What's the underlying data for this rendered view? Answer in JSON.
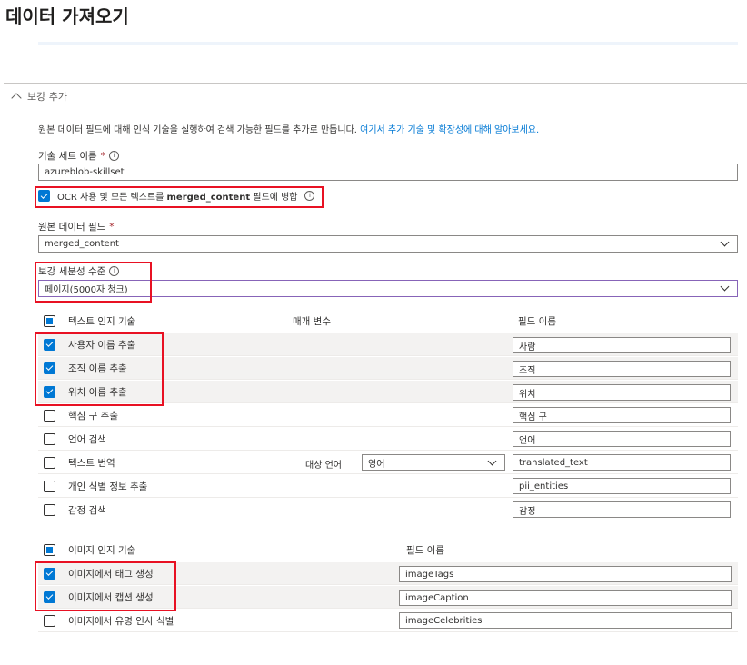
{
  "page": {
    "title": "데이터 가져오기"
  },
  "section": {
    "title": "보강 추가"
  },
  "description": {
    "text": "원본 데이터 필드에 대해 인식 기술을 실행하여 검색 가능한 필드를 추가로 만듭니다. ",
    "link": "여기서 추가 기술 및 확장성에 대해 알아보세요."
  },
  "skillset": {
    "label": "기술 세트 이름",
    "value": "azureblob-skillset"
  },
  "ocr": {
    "label_prefix": "OCR 사용 및 모든 텍스트를 ",
    "label_bold": "merged_content",
    "label_suffix": " 필드에 병합",
    "checked": true
  },
  "source_field": {
    "label": "원본 데이터 필드",
    "value": "merged_content"
  },
  "granularity": {
    "label": "보강 세분성 수준",
    "value": "페이지(5000자 청크)"
  },
  "text_skills": {
    "header": "텍스트 인지 기술",
    "param_header": "매개 변수",
    "field_header": "필드 이름",
    "items": [
      {
        "label": "사용자 이름 추출",
        "checked": true,
        "field": "사람"
      },
      {
        "label": "조직 이름 추출",
        "checked": true,
        "field": "조직"
      },
      {
        "label": "위치 이름 추출",
        "checked": true,
        "field": "위치"
      },
      {
        "label": "핵심 구 추출",
        "checked": false,
        "field": "핵심 구"
      },
      {
        "label": "언어 검색",
        "checked": false,
        "field": "언어"
      },
      {
        "label": "텍스트 번역",
        "checked": false,
        "field": "translated_text",
        "param_label": "대상 언어",
        "param_value": "영어"
      },
      {
        "label": "개인 식별 정보 추출",
        "checked": false,
        "field": "pii_entities"
      },
      {
        "label": "감정 검색",
        "checked": false,
        "field": "감정"
      }
    ]
  },
  "image_skills": {
    "header": "이미지 인지 기술",
    "field_header": "필드 이름",
    "items": [
      {
        "label": "이미지에서 태그 생성",
        "checked": true,
        "field": "imageTags"
      },
      {
        "label": "이미지에서 캡션 생성",
        "checked": true,
        "field": "imageCaption"
      },
      {
        "label": "이미지에서 유명 인사 식별",
        "checked": false,
        "field": "imageCelebrities"
      }
    ]
  },
  "colors": {
    "accent": "#0078d4",
    "highlight": "#e81123",
    "granularity_border": "#8764b8"
  },
  "icons": {
    "info": "info-icon",
    "collapse": "chevron-up-icon",
    "dropdown": "chevron-down-icon",
    "required": "asterisk"
  }
}
